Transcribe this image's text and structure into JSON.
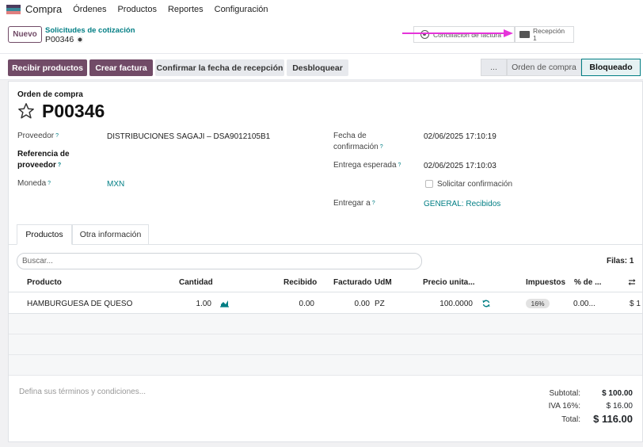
{
  "navbar": {
    "app_name": "Compra",
    "menus": [
      "Órdenes",
      "Productos",
      "Reportes",
      "Configuración"
    ],
    "icon_colors": [
      "#4c3b5e",
      "#3a8a9a",
      "#e07f7f"
    ]
  },
  "control_panel": {
    "new_button": "Nuevo",
    "breadcrumb_parent": "Solicitudes de cotización",
    "breadcrumb_current": "P00346",
    "smart_buttons": {
      "conciliation": "Conciliación de factura",
      "reception_label": "Recepción",
      "reception_count": "1"
    }
  },
  "action_bar": {
    "buttons": [
      "Recibir productos",
      "Crear factura",
      "Confirmar la fecha de recepción",
      "Desbloquear"
    ],
    "status_steps": [
      "...",
      "Orden de compra",
      "Bloqueado"
    ],
    "active_status": "Bloqueado"
  },
  "form": {
    "doc_type": "Orden de compra",
    "doc_number": "P00346",
    "left": {
      "vendor_label": "Proveedor",
      "vendor_value": "DISTRIBUCIONES SAGAJI – DSA9012105B1",
      "vendor_ref_label_1": "Referencia de",
      "vendor_ref_label_2": "proveedor",
      "currency_label": "Moneda",
      "currency_value": "MXN"
    },
    "right": {
      "confirm_date_label_1": "Fecha de",
      "confirm_date_label_2": "confirmación",
      "confirm_date_value": "02/06/2025 17:10:19",
      "expected_label": "Entrega esperada",
      "expected_value": "02/06/2025 17:10:03",
      "request_confirmation_label": "Solicitar confirmación",
      "request_confirmation_checked": false,
      "deliver_to_label": "Entregar a",
      "deliver_to_value": "GENERAL: Recibidos"
    },
    "help_mark": "?"
  },
  "tabs": [
    "Productos",
    "Otra información"
  ],
  "lines": {
    "search_placeholder": "Buscar...",
    "rows_label": "Filas: 1",
    "headers": [
      "Producto",
      "Cantidad",
      "Recibido",
      "Facturado",
      "UdM",
      "Precio unita...",
      "Impuestos",
      "% de ..."
    ],
    "rows": [
      {
        "product": "HAMBURGUESA DE QUESO",
        "quantity": "1.00",
        "received": "0.00",
        "invoiced": "0.00",
        "uom": "PZ",
        "unit_price": "100.0000",
        "taxes": "16%",
        "discount": "0.00...",
        "subtotal": "$ 1"
      }
    ]
  },
  "footer": {
    "terms_placeholder": "Defina sus términos y condiciones...",
    "subtotal_label": "Subtotal:",
    "subtotal_value": "$ 100.00",
    "tax_label": "IVA 16%:",
    "tax_value": "$ 16.00",
    "total_label": "Total:",
    "total_value": "$ 116.00"
  },
  "colors": {
    "primary": "#714b67",
    "link": "#017e84",
    "annotation_arrow": "#e534d9"
  }
}
